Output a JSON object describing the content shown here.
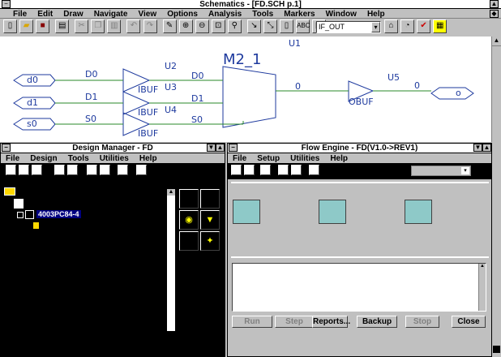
{
  "app": {
    "title": "Schematics - [FD.SCH p.1]",
    "menu": [
      "File",
      "Edit",
      "Draw",
      "Navigate",
      "View",
      "Options",
      "Analysis",
      "Tools",
      "Markers",
      "Window",
      "Help"
    ],
    "net_select": "IF_OUT"
  },
  "schematic": {
    "ports": [
      "d0",
      "d1",
      "s0"
    ],
    "nets_in": [
      "D0",
      "D1",
      "S0"
    ],
    "buffers": [
      "IBUF",
      "IBUF",
      "IBUF"
    ],
    "inst": [
      "U2",
      "U3",
      "U4",
      "U1",
      "U5"
    ],
    "mux_name": "M2_1",
    "mux_pins": [
      "D0",
      "D1",
      "S0"
    ],
    "mux_out": "0",
    "obuf": "OBUF",
    "out_net": "0",
    "out_port": "o"
  },
  "design_manager": {
    "title": "Design Manager - FD",
    "menu": [
      "File",
      "Design",
      "Tools",
      "Utilities",
      "Help"
    ],
    "device": "4003PC84-4"
  },
  "flow_engine": {
    "title": "Flow Engine - FD(V1.0->REV1)",
    "menu": [
      "File",
      "Setup",
      "Utilities",
      "Help"
    ],
    "buttons": [
      "Run",
      "Step",
      "Reports...",
      "Backup",
      "Stop",
      "Close"
    ]
  }
}
